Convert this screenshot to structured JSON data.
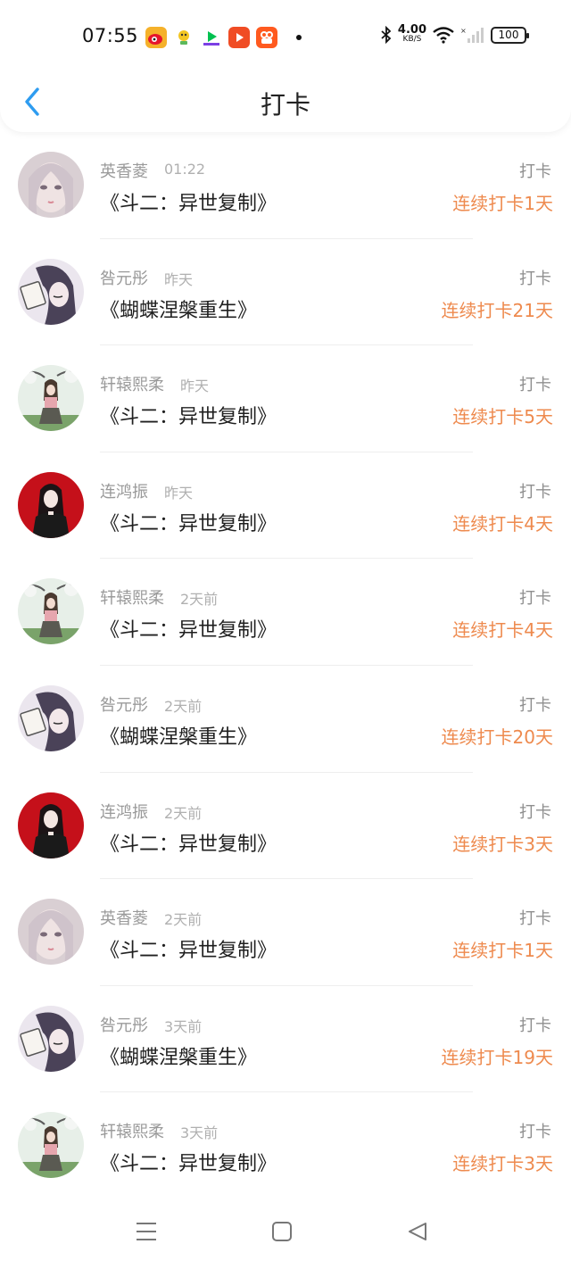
{
  "status_bar": {
    "time": "07:55",
    "net_speed_value": "4.00",
    "net_speed_unit": "KB/S",
    "battery": "100",
    "app_icons": [
      "weibo-icon",
      "app-icon-2",
      "iqiyi-icon",
      "video-player-icon",
      "kuaishou-icon"
    ]
  },
  "header": {
    "title": "打卡"
  },
  "colors": {
    "accent_back": "#2e9cf0",
    "streak": "#ee8a4e"
  },
  "rows": [
    {
      "name": "英香菱",
      "time": "01:22",
      "book": "《斗二：异世复制》",
      "tag": "打卡",
      "streak": "连续打卡1天",
      "avatar": "pale-girl-avatar"
    },
    {
      "name": "咎元彤",
      "time": "昨天",
      "book": "《蝴蝶涅槃重生》",
      "tag": "打卡",
      "streak": "连续打卡21天",
      "avatar": "reading-girl-avatar"
    },
    {
      "name": "轩辕熙柔",
      "time": "昨天",
      "book": "《斗二：异世复制》",
      "tag": "打卡",
      "streak": "连续打卡5天",
      "avatar": "tree-girl-avatar"
    },
    {
      "name": "连鸿振",
      "time": "昨天",
      "book": "《斗二：异世复制》",
      "tag": "打卡",
      "streak": "连续打卡4天",
      "avatar": "red-bg-girl-avatar"
    },
    {
      "name": "轩辕熙柔",
      "time": "2天前",
      "book": "《斗二：异世复制》",
      "tag": "打卡",
      "streak": "连续打卡4天",
      "avatar": "tree-girl-avatar"
    },
    {
      "name": "咎元彤",
      "time": "2天前",
      "book": "《蝴蝶涅槃重生》",
      "tag": "打卡",
      "streak": "连续打卡20天",
      "avatar": "reading-girl-avatar"
    },
    {
      "name": "连鸿振",
      "time": "2天前",
      "book": "《斗二：异世复制》",
      "tag": "打卡",
      "streak": "连续打卡3天",
      "avatar": "red-bg-girl-avatar"
    },
    {
      "name": "英香菱",
      "time": "2天前",
      "book": "《斗二：异世复制》",
      "tag": "打卡",
      "streak": "连续打卡1天",
      "avatar": "pale-girl-avatar"
    },
    {
      "name": "咎元彤",
      "time": "3天前",
      "book": "《蝴蝶涅槃重生》",
      "tag": "打卡",
      "streak": "连续打卡19天",
      "avatar": "reading-girl-avatar"
    },
    {
      "name": "轩辕熙柔",
      "time": "3天前",
      "book": "《斗二：异世复制》",
      "tag": "打卡",
      "streak": "连续打卡3天",
      "avatar": "tree-girl-avatar"
    }
  ],
  "nav_bar": {
    "buttons": [
      "menu-icon",
      "home-square-icon",
      "back-triangle-icon"
    ]
  }
}
